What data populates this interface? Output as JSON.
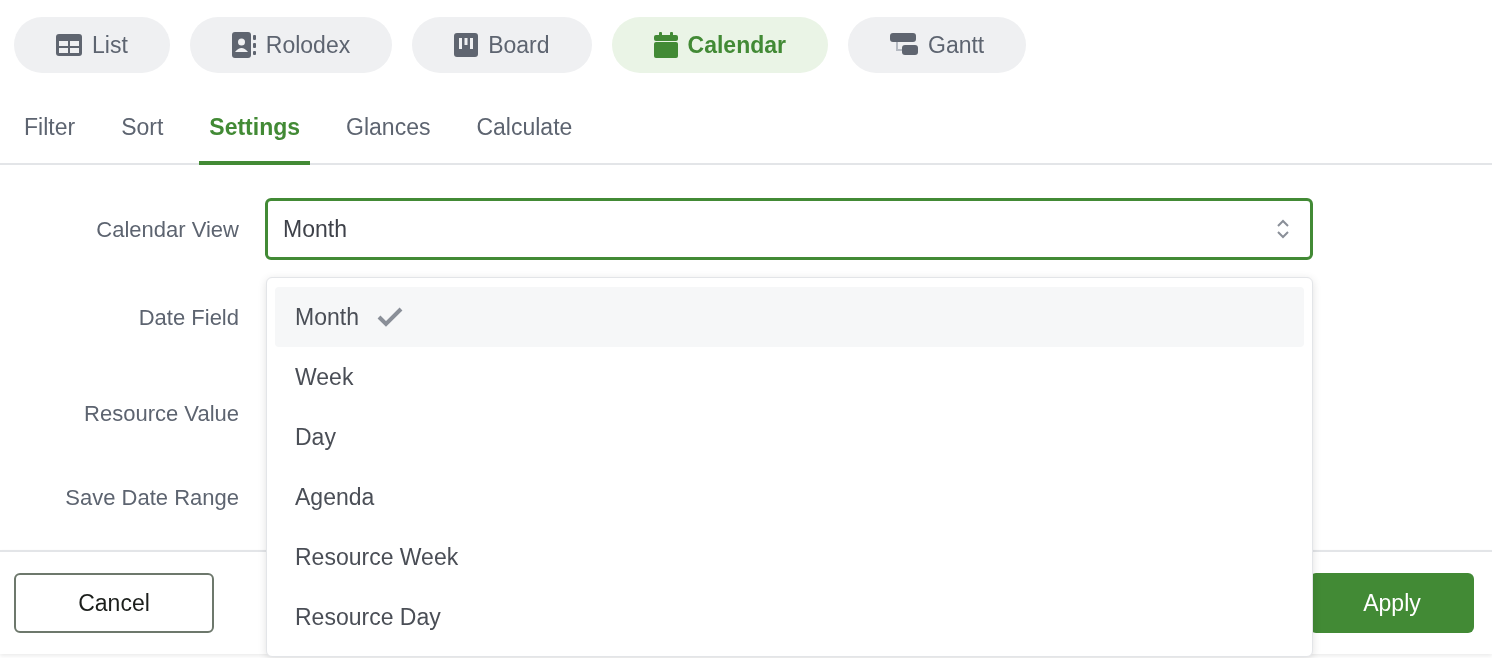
{
  "views": [
    {
      "kind": "list",
      "label": "List",
      "selected": false
    },
    {
      "kind": "rolodex",
      "label": "Rolodex",
      "selected": false
    },
    {
      "kind": "board",
      "label": "Board",
      "selected": false
    },
    {
      "kind": "calendar",
      "label": "Calendar",
      "selected": true
    },
    {
      "kind": "gantt",
      "label": "Gantt",
      "selected": false
    }
  ],
  "tabs": [
    {
      "label": "Filter",
      "selected": false
    },
    {
      "label": "Sort",
      "selected": false
    },
    {
      "label": "Settings",
      "selected": true
    },
    {
      "label": "Glances",
      "selected": false
    },
    {
      "label": "Calculate",
      "selected": false
    }
  ],
  "fields": [
    {
      "label": "Calendar View",
      "value": "Month"
    },
    {
      "label": "Date Field"
    },
    {
      "label": "Resource Value"
    },
    {
      "label": "Save Date Range"
    }
  ],
  "dropdown": {
    "options": [
      {
        "label": "Month",
        "selected": true
      },
      {
        "label": "Week",
        "selected": false
      },
      {
        "label": "Day",
        "selected": false
      },
      {
        "label": "Agenda",
        "selected": false
      },
      {
        "label": "Resource Week",
        "selected": false
      },
      {
        "label": "Resource Day",
        "selected": false
      }
    ]
  },
  "buttons": {
    "cancel": "Cancel",
    "apply": "Apply"
  }
}
